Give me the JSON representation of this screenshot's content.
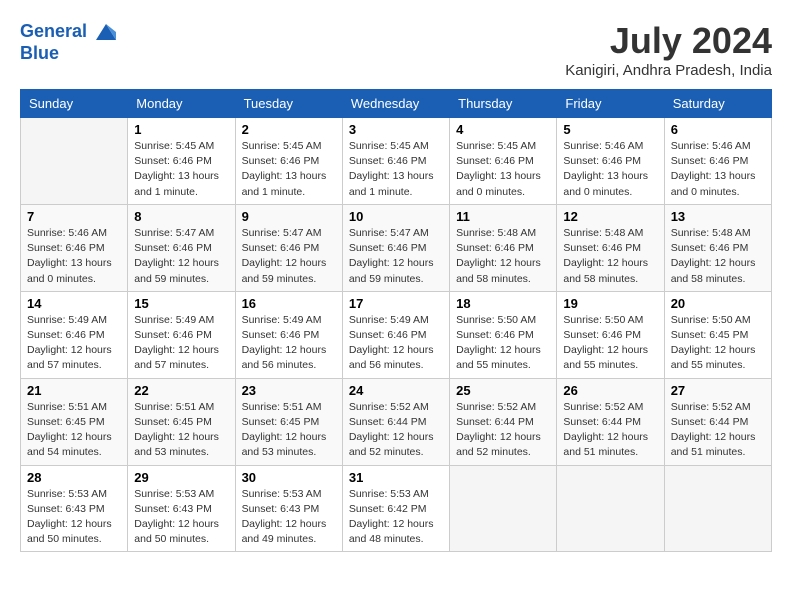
{
  "header": {
    "logo_line1": "General",
    "logo_line2": "Blue",
    "month_title": "July 2024",
    "location": "Kanigiri, Andhra Pradesh, India"
  },
  "days_of_week": [
    "Sunday",
    "Monday",
    "Tuesday",
    "Wednesday",
    "Thursday",
    "Friday",
    "Saturday"
  ],
  "weeks": [
    [
      {
        "day": "",
        "info": ""
      },
      {
        "day": "1",
        "info": "Sunrise: 5:45 AM\nSunset: 6:46 PM\nDaylight: 13 hours\nand 1 minute."
      },
      {
        "day": "2",
        "info": "Sunrise: 5:45 AM\nSunset: 6:46 PM\nDaylight: 13 hours\nand 1 minute."
      },
      {
        "day": "3",
        "info": "Sunrise: 5:45 AM\nSunset: 6:46 PM\nDaylight: 13 hours\nand 1 minute."
      },
      {
        "day": "4",
        "info": "Sunrise: 5:45 AM\nSunset: 6:46 PM\nDaylight: 13 hours\nand 0 minutes."
      },
      {
        "day": "5",
        "info": "Sunrise: 5:46 AM\nSunset: 6:46 PM\nDaylight: 13 hours\nand 0 minutes."
      },
      {
        "day": "6",
        "info": "Sunrise: 5:46 AM\nSunset: 6:46 PM\nDaylight: 13 hours\nand 0 minutes."
      }
    ],
    [
      {
        "day": "7",
        "info": "Sunrise: 5:46 AM\nSunset: 6:46 PM\nDaylight: 13 hours\nand 0 minutes."
      },
      {
        "day": "8",
        "info": "Sunrise: 5:47 AM\nSunset: 6:46 PM\nDaylight: 12 hours\nand 59 minutes."
      },
      {
        "day": "9",
        "info": "Sunrise: 5:47 AM\nSunset: 6:46 PM\nDaylight: 12 hours\nand 59 minutes."
      },
      {
        "day": "10",
        "info": "Sunrise: 5:47 AM\nSunset: 6:46 PM\nDaylight: 12 hours\nand 59 minutes."
      },
      {
        "day": "11",
        "info": "Sunrise: 5:48 AM\nSunset: 6:46 PM\nDaylight: 12 hours\nand 58 minutes."
      },
      {
        "day": "12",
        "info": "Sunrise: 5:48 AM\nSunset: 6:46 PM\nDaylight: 12 hours\nand 58 minutes."
      },
      {
        "day": "13",
        "info": "Sunrise: 5:48 AM\nSunset: 6:46 PM\nDaylight: 12 hours\nand 58 minutes."
      }
    ],
    [
      {
        "day": "14",
        "info": "Sunrise: 5:49 AM\nSunset: 6:46 PM\nDaylight: 12 hours\nand 57 minutes."
      },
      {
        "day": "15",
        "info": "Sunrise: 5:49 AM\nSunset: 6:46 PM\nDaylight: 12 hours\nand 57 minutes."
      },
      {
        "day": "16",
        "info": "Sunrise: 5:49 AM\nSunset: 6:46 PM\nDaylight: 12 hours\nand 56 minutes."
      },
      {
        "day": "17",
        "info": "Sunrise: 5:49 AM\nSunset: 6:46 PM\nDaylight: 12 hours\nand 56 minutes."
      },
      {
        "day": "18",
        "info": "Sunrise: 5:50 AM\nSunset: 6:46 PM\nDaylight: 12 hours\nand 55 minutes."
      },
      {
        "day": "19",
        "info": "Sunrise: 5:50 AM\nSunset: 6:46 PM\nDaylight: 12 hours\nand 55 minutes."
      },
      {
        "day": "20",
        "info": "Sunrise: 5:50 AM\nSunset: 6:45 PM\nDaylight: 12 hours\nand 55 minutes."
      }
    ],
    [
      {
        "day": "21",
        "info": "Sunrise: 5:51 AM\nSunset: 6:45 PM\nDaylight: 12 hours\nand 54 minutes."
      },
      {
        "day": "22",
        "info": "Sunrise: 5:51 AM\nSunset: 6:45 PM\nDaylight: 12 hours\nand 53 minutes."
      },
      {
        "day": "23",
        "info": "Sunrise: 5:51 AM\nSunset: 6:45 PM\nDaylight: 12 hours\nand 53 minutes."
      },
      {
        "day": "24",
        "info": "Sunrise: 5:52 AM\nSunset: 6:44 PM\nDaylight: 12 hours\nand 52 minutes."
      },
      {
        "day": "25",
        "info": "Sunrise: 5:52 AM\nSunset: 6:44 PM\nDaylight: 12 hours\nand 52 minutes."
      },
      {
        "day": "26",
        "info": "Sunrise: 5:52 AM\nSunset: 6:44 PM\nDaylight: 12 hours\nand 51 minutes."
      },
      {
        "day": "27",
        "info": "Sunrise: 5:52 AM\nSunset: 6:44 PM\nDaylight: 12 hours\nand 51 minutes."
      }
    ],
    [
      {
        "day": "28",
        "info": "Sunrise: 5:53 AM\nSunset: 6:43 PM\nDaylight: 12 hours\nand 50 minutes."
      },
      {
        "day": "29",
        "info": "Sunrise: 5:53 AM\nSunset: 6:43 PM\nDaylight: 12 hours\nand 50 minutes."
      },
      {
        "day": "30",
        "info": "Sunrise: 5:53 AM\nSunset: 6:43 PM\nDaylight: 12 hours\nand 49 minutes."
      },
      {
        "day": "31",
        "info": "Sunrise: 5:53 AM\nSunset: 6:42 PM\nDaylight: 12 hours\nand 48 minutes."
      },
      {
        "day": "",
        "info": ""
      },
      {
        "day": "",
        "info": ""
      },
      {
        "day": "",
        "info": ""
      }
    ]
  ]
}
